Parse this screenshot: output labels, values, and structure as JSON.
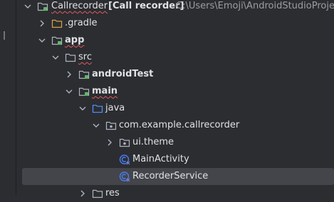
{
  "project_tree": {
    "rows": [
      {
        "label": "Callrecorder",
        "module_label": "[Call recorder]",
        "path": "C:\\Users\\Emoji\\AndroidStudioProjects"
      },
      {
        "label": ".gradle"
      },
      {
        "label": "app"
      },
      {
        "label": "src"
      },
      {
        "label": "androidTest"
      },
      {
        "label": "main"
      },
      {
        "label": "java"
      },
      {
        "label": "com.example.callrecorder"
      },
      {
        "label": "ui.theme"
      },
      {
        "label": "MainActivity"
      },
      {
        "label": "RecorderService"
      },
      {
        "label": "res"
      }
    ]
  },
  "colors": {
    "background": "#2b2d30",
    "selection": "#43454a",
    "folder_icon": "#aeb3c2",
    "source_folder_icon": "#548af7",
    "module_dot": "#5fb865",
    "gradle_folder": "#d9a441",
    "kotlin_class_icon": "#4c7cf5",
    "error_underline": "#e55765"
  }
}
